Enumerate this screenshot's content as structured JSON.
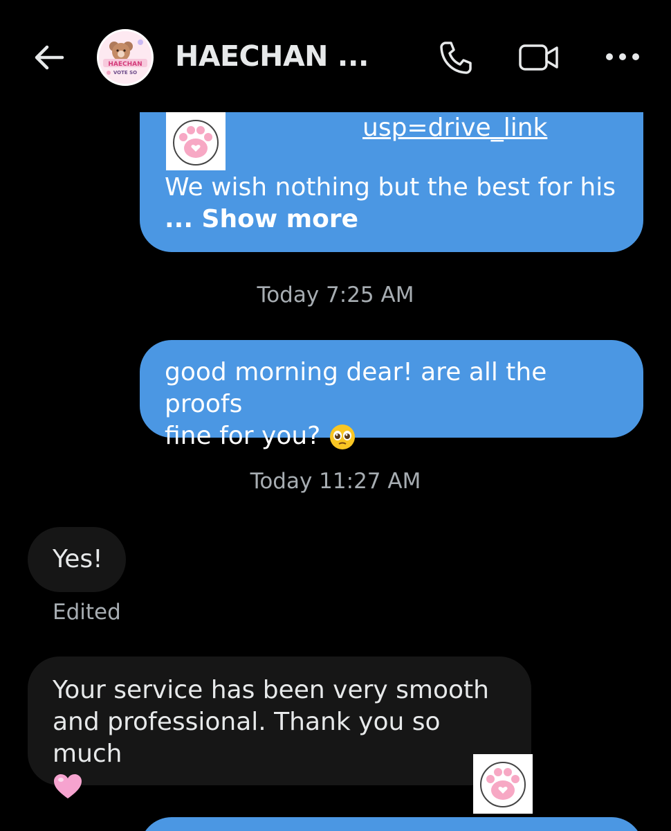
{
  "header": {
    "title": "HAECHAN ...",
    "avatar_text_top": "HAECHAN",
    "avatar_text_bottom": "VOTE SO",
    "icons": [
      "back-arrow-icon",
      "phone-icon",
      "video-camera-icon",
      "more-dots-icon"
    ]
  },
  "messages": [
    {
      "direction": "sent",
      "link_text": "usp=drive_link",
      "text": "We wish nothing but the best for his",
      "show_more": "... Show more"
    },
    {
      "type": "timestamp",
      "text": "Today 7:25 AM"
    },
    {
      "direction": "sent",
      "line1": "good morning dear! are all the proofs",
      "line2": "fine for you?",
      "emoji": "pleading-face-emoji"
    },
    {
      "type": "timestamp",
      "text": "Today 11:27 AM"
    },
    {
      "direction": "received",
      "text": "Yes!",
      "status": "Edited"
    },
    {
      "direction": "received",
      "line1": "Your service has been very smooth",
      "line2": "and professional. Thank you so much",
      "emoji": "pink-heart-emoji"
    }
  ],
  "colors": {
    "background": "#000000",
    "sent_bubble": "#4b97e3",
    "received_bubble": "#161616",
    "timestamp": "#a7adb2"
  }
}
